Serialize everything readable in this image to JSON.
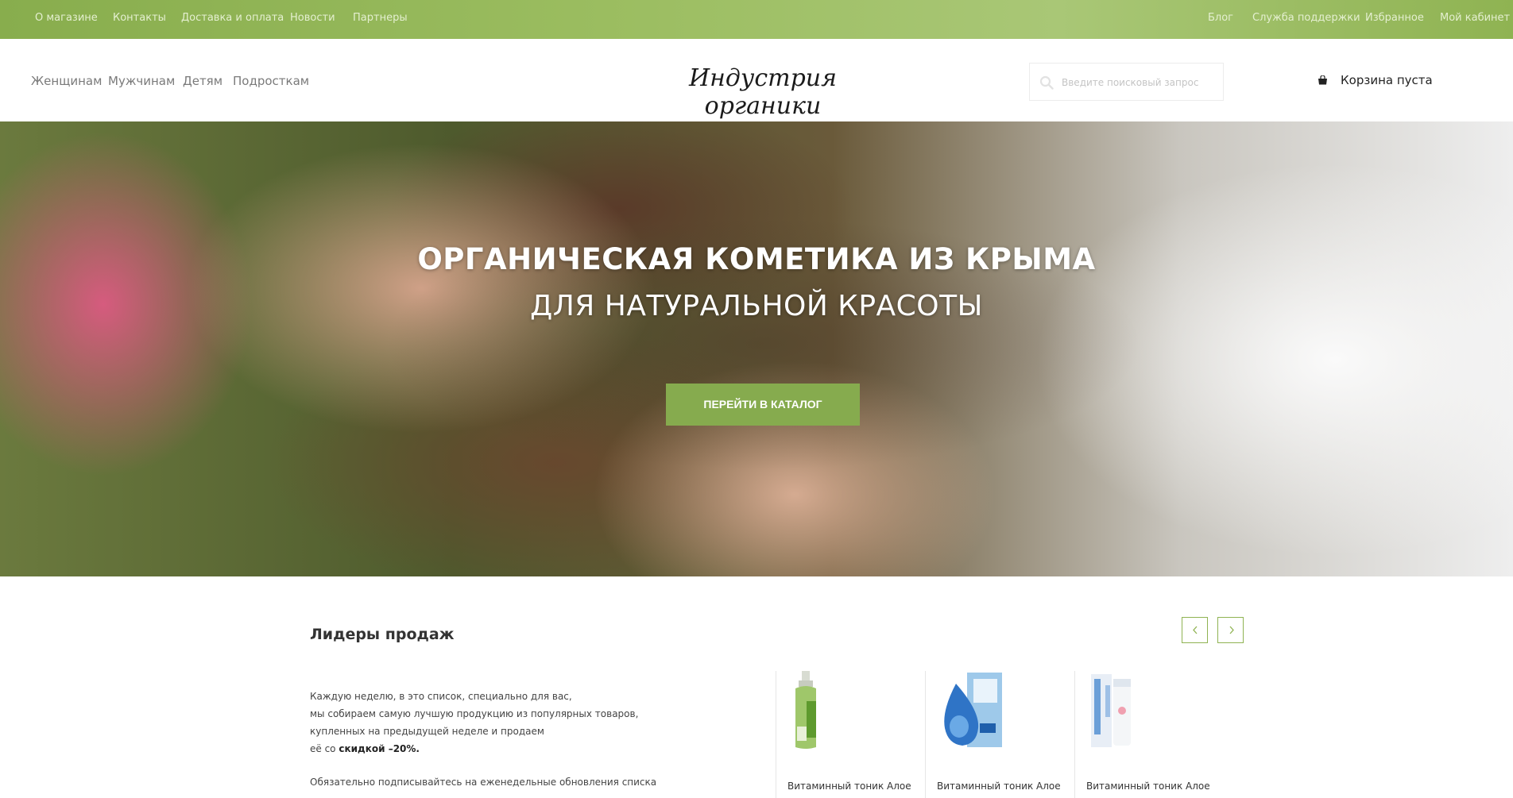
{
  "topbar": {
    "left_links": [
      "О магазине",
      "Контакты",
      "Доставка и оплата",
      "Новости",
      "Партнеры"
    ],
    "right_links": [
      "Блог",
      "Служба поддержки",
      "Избранное",
      "Мой кабинет"
    ]
  },
  "header": {
    "categories": [
      "Женщинам",
      "Мужчинам",
      "Детям",
      "Подросткам"
    ],
    "logo_text": "Индустрия органики",
    "search_placeholder": "Введите поисковый запрос",
    "cart_label": "Корзина пуста"
  },
  "hero": {
    "title": "ОРГАНИЧЕСКАЯ КОМЕТИКА ИЗ КРЫМА",
    "subtitle": "ДЛЯ НАТУРАЛЬНОЙ КРАСОТЫ",
    "cta_label": "ПЕРЕЙТИ В КАТАЛОГ"
  },
  "bestsellers": {
    "heading": "Лидеры продаж",
    "description_lines": [
      "Каждую неделю, в это список, специально для вас,",
      "мы собираем самую лучшую продукцию из популярных товаров,",
      "купленных на предыдущей неделе и продаем",
      "её со"
    ],
    "discount_text": "скидкой –20%.",
    "more_text": "Обязательно подписывайтесь на еженедельные обновления списка",
    "products": [
      {
        "name": "Витаминный тоник Алое"
      },
      {
        "name": "Витаминный тоник Алое"
      },
      {
        "name": "Витаминный тоник Алое"
      }
    ]
  },
  "colors": {
    "accent": "#86ab4e",
    "topbar": "#9bbd60"
  }
}
